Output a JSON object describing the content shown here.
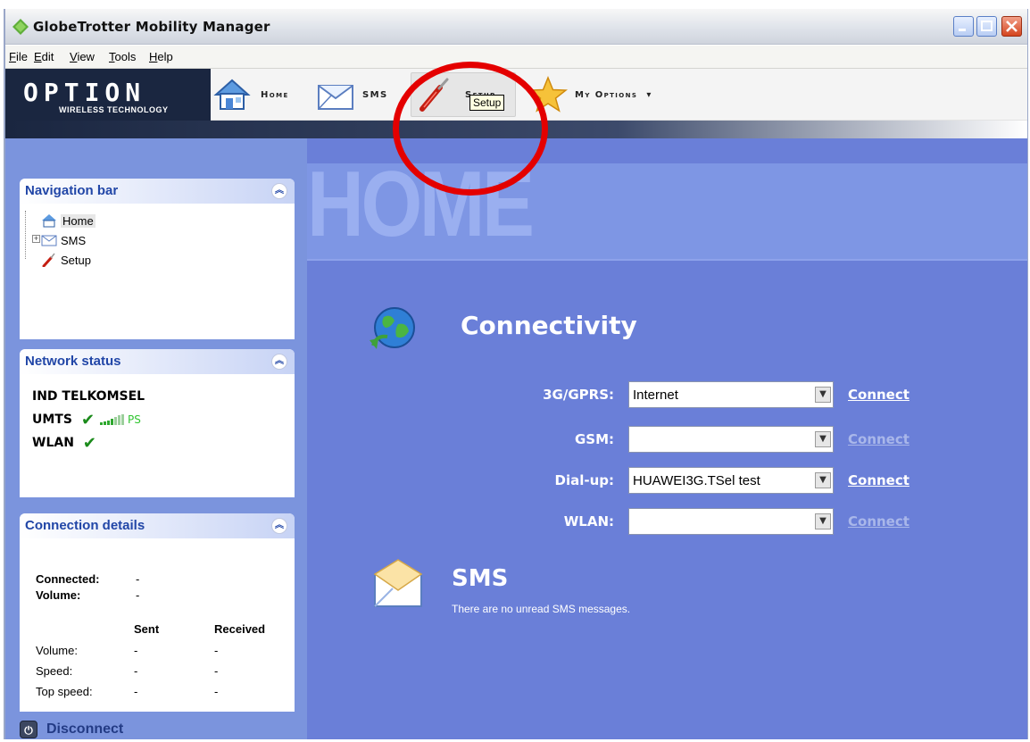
{
  "window": {
    "title": "GlobeTrotter Mobility Manager"
  },
  "menu": [
    "File",
    "Edit",
    "View",
    "Tools",
    "Help"
  ],
  "toolbar": {
    "logo": "OPTION",
    "logo_sub": "WIRELESS TECHNOLOGY",
    "buttons": {
      "home": "Home",
      "sms": "SMS",
      "setup": "Setup",
      "options": "My Options"
    },
    "options_arrow": "▾",
    "tooltip": "Setup"
  },
  "nav": {
    "title": "Navigation bar",
    "items": [
      {
        "label": "Home",
        "icon": "home-icon",
        "selected": true
      },
      {
        "label": "SMS",
        "icon": "envelope-icon",
        "expandable": true
      },
      {
        "label": "Setup",
        "icon": "wrench-icon"
      }
    ]
  },
  "network": {
    "title": "Network status",
    "operator": "IND TELKOMSEL",
    "umts_label": "UMTS",
    "umts_status": "✔",
    "ps": "PS",
    "wlan_label": "WLAN",
    "wlan_status": "✔"
  },
  "connection": {
    "title": "Connection details",
    "connected_label": "Connected:",
    "connected_value": "-",
    "volume_label": "Volume:",
    "volume_value": "-",
    "col_sent": "Sent",
    "col_received": "Received",
    "rows": [
      {
        "label": "Volume:",
        "sent": "-",
        "received": "-"
      },
      {
        "label": "Speed:",
        "sent": "-",
        "received": "-"
      },
      {
        "label": "Top speed:",
        "sent": "-",
        "received": "-"
      }
    ]
  },
  "disconnect": {
    "label": "Disconnect",
    "icon_glyph": "⏻"
  },
  "main": {
    "header": "HOME",
    "connectivity_title": "Connectivity",
    "connections": [
      {
        "label": "3G/GPRS:",
        "value": "Internet",
        "link": "Connect",
        "enabled": true
      },
      {
        "label": "GSM:",
        "value": "",
        "link": "Connect",
        "enabled": false
      },
      {
        "label": "Dial-up:",
        "value": "HUAWEI3G.TSel test",
        "link": "Connect",
        "enabled": true
      },
      {
        "label": "WLAN:",
        "value": "",
        "link": "Connect",
        "enabled": false
      }
    ],
    "sms_title": "SMS",
    "sms_message": "There are no unread SMS messages."
  },
  "colors": {
    "accent_red": "#e40000",
    "main_bg": "#6a7fd8",
    "link_white": "#ffffff",
    "link_disabled": "#a9b7ea"
  }
}
